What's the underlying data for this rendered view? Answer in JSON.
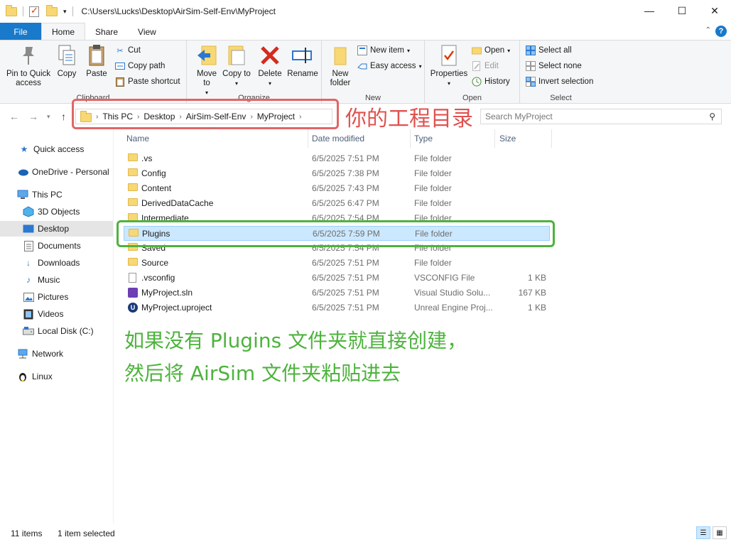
{
  "window": {
    "title": "C:\\Users\\Lucks\\Desktop\\AirSim-Self-Env\\MyProject",
    "minimize": "—",
    "maximize": "☐",
    "close": "✕"
  },
  "tabs": [
    "File",
    "Home",
    "Share",
    "View"
  ],
  "ribbon": {
    "clipboard": {
      "label": "Clipboard",
      "pin": "Pin to Quick access",
      "copy": "Copy",
      "paste": "Paste",
      "cut": "Cut",
      "copy_path": "Copy path",
      "paste_shortcut": "Paste shortcut"
    },
    "organize": {
      "label": "Organize",
      "move_to": "Move to",
      "copy_to": "Copy to",
      "delete": "Delete",
      "rename": "Rename"
    },
    "new": {
      "label": "New",
      "new_folder": "New folder",
      "new_item": "New item",
      "easy_access": "Easy access"
    },
    "open": {
      "label": "Open",
      "properties": "Properties",
      "open": "Open",
      "edit": "Edit",
      "history": "History"
    },
    "select": {
      "label": "Select",
      "select_all": "Select all",
      "select_none": "Select none",
      "invert": "Invert selection"
    }
  },
  "address": {
    "crumbs": [
      "This PC",
      "Desktop",
      "AirSim-Self-Env",
      "MyProject"
    ],
    "search_placeholder": "Search MyProject"
  },
  "annotations": {
    "red": "你的工程目录",
    "green_line1": "如果没有 Plugins 文件夹就直接创建，",
    "green_line2": "然后将 AirSim 文件夹粘贴进去"
  },
  "nav": [
    {
      "label": "Quick access",
      "icon": "star-icon"
    },
    {
      "label": "OneDrive - Personal",
      "icon": "cloud-icon"
    },
    {
      "label": "This PC",
      "icon": "computer-icon"
    },
    {
      "label": "3D Objects",
      "icon": "cube-icon"
    },
    {
      "label": "Desktop",
      "icon": "desktop-icon"
    },
    {
      "label": "Documents",
      "icon": "document-icon"
    },
    {
      "label": "Downloads",
      "icon": "download-icon"
    },
    {
      "label": "Music",
      "icon": "music-icon"
    },
    {
      "label": "Pictures",
      "icon": "picture-icon"
    },
    {
      "label": "Videos",
      "icon": "video-icon"
    },
    {
      "label": "Local Disk (C:)",
      "icon": "disk-icon"
    },
    {
      "label": "Network",
      "icon": "network-icon"
    },
    {
      "label": "Linux",
      "icon": "linux-icon"
    }
  ],
  "columns": [
    "Name",
    "Date modified",
    "Type",
    "Size"
  ],
  "files": [
    {
      "name": ".vs",
      "date": "6/5/2025 7:51 PM",
      "type": "File folder",
      "size": "",
      "kind": "folder"
    },
    {
      "name": "Config",
      "date": "6/5/2025 7:38 PM",
      "type": "File folder",
      "size": "",
      "kind": "folder"
    },
    {
      "name": "Content",
      "date": "6/5/2025 7:43 PM",
      "type": "File folder",
      "size": "",
      "kind": "folder"
    },
    {
      "name": "DerivedDataCache",
      "date": "6/5/2025 6:47 PM",
      "type": "File folder",
      "size": "",
      "kind": "folder"
    },
    {
      "name": "Intermediate",
      "date": "6/5/2025 7:54 PM",
      "type": "File folder",
      "size": "",
      "kind": "folder"
    },
    {
      "name": "Plugins",
      "date": "6/5/2025 7:59 PM",
      "type": "File folder",
      "size": "",
      "kind": "folder"
    },
    {
      "name": "Saved",
      "date": "6/5/2025 7:54 PM",
      "type": "File folder",
      "size": "",
      "kind": "folder"
    },
    {
      "name": "Source",
      "date": "6/5/2025 7:51 PM",
      "type": "File folder",
      "size": "",
      "kind": "folder"
    },
    {
      "name": ".vsconfig",
      "date": "6/5/2025 7:51 PM",
      "type": "VSCONFIG File",
      "size": "1 KB",
      "kind": "file"
    },
    {
      "name": "MyProject.sln",
      "date": "6/5/2025 7:51 PM",
      "type": "Visual Studio Solu...",
      "size": "167 KB",
      "kind": "sln"
    },
    {
      "name": "MyProject.uproject",
      "date": "6/5/2025 7:51 PM",
      "type": "Unreal Engine Proj...",
      "size": "1 KB",
      "kind": "uproject"
    }
  ],
  "status": {
    "count": "11 items",
    "selected": "1 item selected"
  }
}
